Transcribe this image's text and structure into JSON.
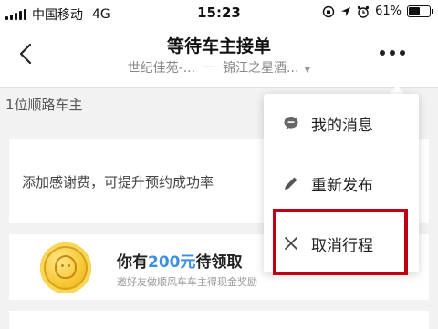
{
  "status_bar": {
    "carrier": "中国移动",
    "network": "4G",
    "time": "15:23",
    "battery": "61%",
    "battery_level": 0.61
  },
  "header": {
    "title": "等待车主接单",
    "route_from": "世纪佳苑-...",
    "route_sep": "一",
    "route_to": "锦江之星酒..."
  },
  "driver_count": "1位顺路车主",
  "thanks_fee": {
    "text": "添加感谢费，可提升预约成功率"
  },
  "reward": {
    "title_prefix": "你有",
    "amount": "200元",
    "title_suffix": "待领取",
    "subtitle": "邀好友做顺风车车主得现金奖励"
  },
  "menu": {
    "items": [
      {
        "label": "我的消息",
        "icon": "message-icon"
      },
      {
        "label": "重新发布",
        "icon": "pencil-icon"
      },
      {
        "label": "取消行程",
        "icon": "close-icon"
      }
    ]
  },
  "colors": {
    "accent_blue": "#3a8ee6",
    "highlight_red": "#c00010"
  }
}
